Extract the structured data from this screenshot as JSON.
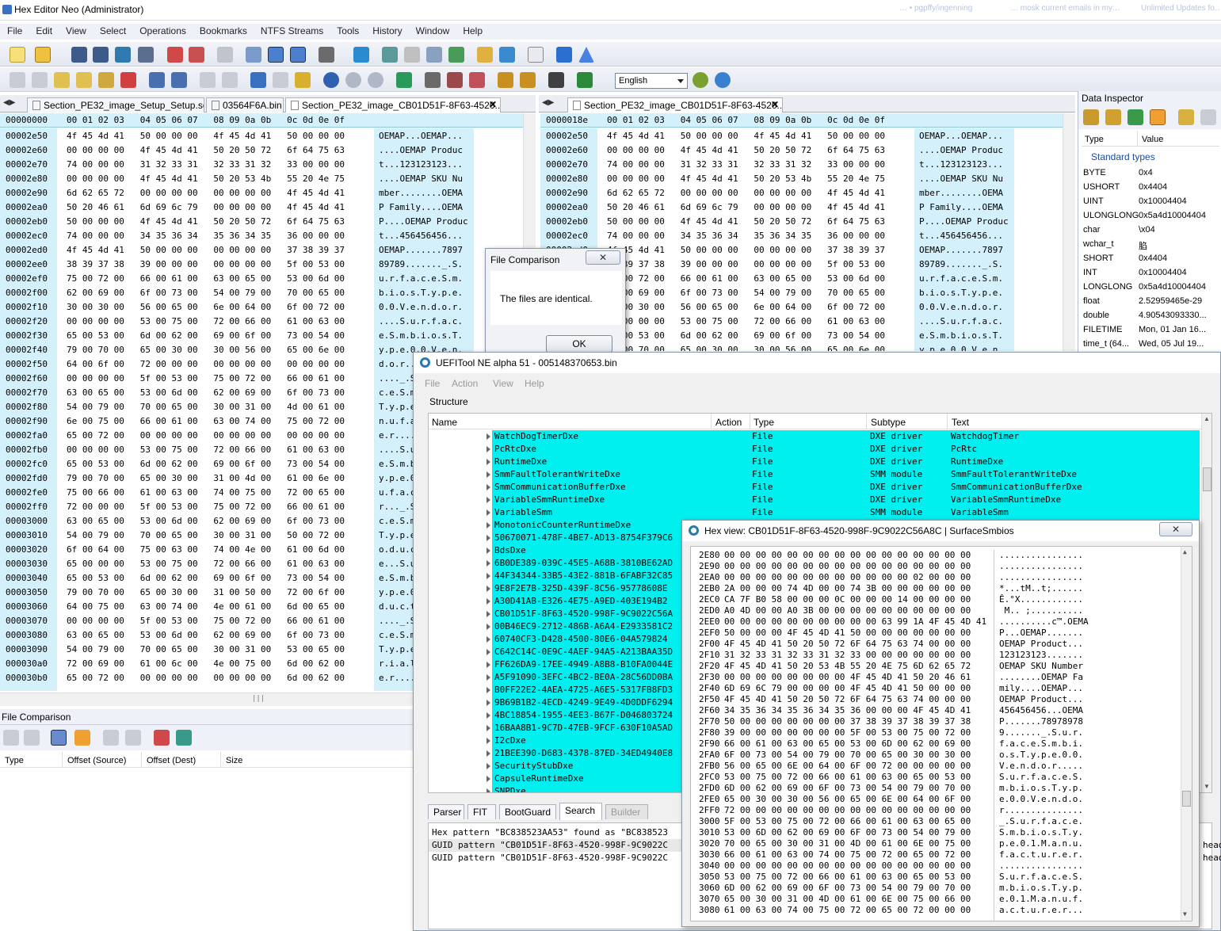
{
  "app": {
    "title": "Hex Editor Neo (Administrator)"
  },
  "taskbar_faint": [
    "… • pgpffy/ingenning",
    "… mosk current emails in my…",
    "Unlimited Updates fo…"
  ],
  "menu": [
    "File",
    "Edit",
    "View",
    "Select",
    "Operations",
    "Bookmarks",
    "NTFS Streams",
    "Tools",
    "History",
    "Window",
    "Help"
  ],
  "toolbar": {
    "language": "English"
  },
  "left_editor": {
    "tabs": [
      "Section_PE32_image_Setup_Setup.sct",
      "03564F6A.bin",
      "Section_PE32_image_CB01D51F-8F63-4520..."
    ],
    "header_offset": "00000000",
    "header_cols": "00 01 02 03   04 05 06 07   08 09 0a 0b   0c 0d 0e 0f",
    "rows": [
      {
        "off": "00002e50",
        "hex": "4f 45 4d 41   50 00 00 00   4f 45 4d 41   50 00 00 00",
        "asc": "OEMAP...OEMAP..."
      },
      {
        "off": "00002e60",
        "hex": "00 00 00 00   4f 45 4d 41   50 20 50 72   6f 64 75 63",
        "asc": "....OEMAP Produc"
      },
      {
        "off": "00002e70",
        "hex": "74 00 00 00   31 32 33 31   32 33 31 32   33 00 00 00",
        "asc": "t...123123123..."
      },
      {
        "off": "00002e80",
        "hex": "00 00 00 00   4f 45 4d 41   50 20 53 4b   55 20 4e 75",
        "asc": "....OEMAP SKU Nu"
      },
      {
        "off": "00002e90",
        "hex": "6d 62 65 72   00 00 00 00   00 00 00 00   4f 45 4d 41",
        "asc": "mber........OEMA"
      },
      {
        "off": "00002ea0",
        "hex": "50 20 46 61   6d 69 6c 79   00 00 00 00   4f 45 4d 41",
        "asc": "P Family....OEMA"
      },
      {
        "off": "00002eb0",
        "hex": "50 00 00 00   4f 45 4d 41   50 20 50 72   6f 64 75 63",
        "asc": "P....OEMAP Produc"
      },
      {
        "off": "00002ec0",
        "hex": "74 00 00 00   34 35 36 34   35 36 34 35   36 00 00 00",
        "asc": "t...456456456..."
      },
      {
        "off": "00002ed0",
        "hex": "4f 45 4d 41   50 00 00 00   00 00 00 00   37 38 39 37",
        "asc": "OEMAP.......7897"
      },
      {
        "off": "00002ee0",
        "hex": "38 39 37 38   39 00 00 00   00 00 00 00   5f 00 53 00",
        "asc": "89789......._.S."
      },
      {
        "off": "00002ef0",
        "hex": "75 00 72 00   66 00 61 00   63 00 65 00   53 00 6d 00",
        "asc": "u.r.f.a.c.e.S.m."
      },
      {
        "off": "00002f00",
        "hex": "62 00 69 00   6f 00 73 00   54 00 79 00   70 00 65 00",
        "asc": "b.i.o.s.T.y.p.e."
      },
      {
        "off": "00002f10",
        "hex": "30 00 30 00   56 00 65 00   6e 00 64 00   6f 00 72 00",
        "asc": "0.0.V.e.n.d.o.r."
      },
      {
        "off": "00002f20",
        "hex": "00 00 00 00   53 00 75 00   72 00 66 00   61 00 63 00",
        "asc": "....S.u.r.f.a.c."
      },
      {
        "off": "00002f30",
        "hex": "65 00 53 00   6d 00 62 00   69 00 6f 00   73 00 54 00",
        "asc": "e.S.m.b.i.o.s.T."
      },
      {
        "off": "00002f40",
        "hex": "79 00 70 00   65 00 30 00   30 00 56 00   65 00 6e 00",
        "asc": "y.p.e.0.0.V.e.n."
      },
      {
        "off": "00002f50",
        "hex": "64 00 6f 00   72 00 00 00   00 00 00 00   00 00 00 00",
        "asc": "d.o.r..........."
      },
      {
        "off": "00002f60",
        "hex": "00 00 00 00   5f 00 53 00   75 00 72 00   66 00 61 00",
        "asc": "...._.S.u.r.f.a."
      },
      {
        "off": "00002f70",
        "hex": "63 00 65 00   53 00 6d 00   62 00 69 00   6f 00 73 00",
        "asc": "c.e.S.m.b.i.o.s."
      },
      {
        "off": "00002f80",
        "hex": "54 00 79 00   70 00 65 00   30 00 31 00   4d 00 61 00",
        "asc": "T.y.p.e.0.1.M.a."
      },
      {
        "off": "00002f90",
        "hex": "6e 00 75 00   66 00 61 00   63 00 74 00   75 00 72 00",
        "asc": "n.u.f.a.c.t.u.r."
      },
      {
        "off": "00002fa0",
        "hex": "65 00 72 00   00 00 00 00   00 00 00 00   00 00 00 00",
        "asc": "e.r............."
      },
      {
        "off": "00002fb0",
        "hex": "00 00 00 00   53 00 75 00   72 00 66 00   61 00 63 00",
        "asc": "....S.u.r.f.a.c."
      },
      {
        "off": "00002fc0",
        "hex": "65 00 53 00   6d 00 62 00   69 00 6f 00   73 00 54 00",
        "asc": "e.S.m.b.i.o.s.T."
      },
      {
        "off": "00002fd0",
        "hex": "79 00 70 00   65 00 30 00   31 00 4d 00   61 00 6e 00",
        "asc": "y.p.e.0.1.M.a.n."
      },
      {
        "off": "00002fe0",
        "hex": "75 00 66 00   61 00 63 00   74 00 75 00   72 00 65 00",
        "asc": "u.f.a.c.t.u.r.e."
      },
      {
        "off": "00002ff0",
        "hex": "72 00 00 00   5f 00 53 00   75 00 72 00   66 00 61 00",
        "asc": "r..._.S.u.r.f.a."
      },
      {
        "off": "00003000",
        "hex": "63 00 65 00   53 00 6d 00   62 00 69 00   6f 00 73 00",
        "asc": "c.e.S.m.b.i.o.s."
      },
      {
        "off": "00003010",
        "hex": "54 00 79 00   70 00 65 00   30 00 31 00   50 00 72 00",
        "asc": "T.y.p.e.0.1.P.r."
      },
      {
        "off": "00003020",
        "hex": "6f 00 64 00   75 00 63 00   74 00 4e 00   61 00 6d 00",
        "asc": "o.d.u.c.t.N.a.m."
      },
      {
        "off": "00003030",
        "hex": "65 00 00 00   53 00 75 00   72 00 66 00   61 00 63 00",
        "asc": "e...S.u.r.f.a.c."
      },
      {
        "off": "00003040",
        "hex": "65 00 53 00   6d 00 62 00   69 00 6f 00   73 00 54 00",
        "asc": "e.S.m.b.i.o.s.T."
      },
      {
        "off": "00003050",
        "hex": "79 00 70 00   65 00 30 00   31 00 50 00   72 00 6f 00",
        "asc": "y.p.e.0.1.P.r.o."
      },
      {
        "off": "00003060",
        "hex": "64 00 75 00   63 00 74 00   4e 00 61 00   6d 00 65 00",
        "asc": "d.u.c.t.N.a.m.e."
      },
      {
        "off": "00003070",
        "hex": "00 00 00 00   5f 00 53 00   75 00 72 00   66 00 61 00",
        "asc": "...._.S.u.r.f.a."
      },
      {
        "off": "00003080",
        "hex": "63 00 65 00   53 00 6d 00   62 00 69 00   6f 00 73 00",
        "asc": "c.e.S.m.b.i.o.s."
      },
      {
        "off": "00003090",
        "hex": "54 00 79 00   70 00 65 00   30 00 31 00   53 00 65 00",
        "asc": "T.y.p.e.0.1.S.e."
      },
      {
        "off": "000030a0",
        "hex": "72 00 69 00   61 00 6c 00   4e 00 75 00   6d 00 62 00",
        "asc": "r.i.a.l.N.u.m.b."
      },
      {
        "off": "000030b0",
        "hex": "65 00 72 00   00 00 00 00   00 00 00 00   6d 00 62 00",
        "asc": "e.r.........m.b."
      }
    ]
  },
  "right_editor": {
    "tabs": [
      "Section_PE32_image_CB01D51F-8F63-4520..."
    ],
    "header_offset": "0000018e",
    "header_cols": "00 01 02 03   04 05 06 07   08 09 0a 0b   0c 0d 0e 0f",
    "rows": [
      {
        "off": "00002e50",
        "hex": "4f 45 4d 41   50 00 00 00   4f 45 4d 41   50 00 00 00",
        "asc": "OEMAP...OEMAP..."
      },
      {
        "off": "00002e60",
        "hex": "00 00 00 00   4f 45 4d 41   50 20 50 72   6f 64 75 63",
        "asc": "....OEMAP Produc"
      },
      {
        "off": "00002e70",
        "hex": "74 00 00 00   31 32 33 31   32 33 31 32   33 00 00 00",
        "asc": "t...123123123..."
      },
      {
        "off": "00002e80",
        "hex": "00 00 00 00   4f 45 4d 41   50 20 53 4b   55 20 4e 75",
        "asc": "....OEMAP SKU Nu"
      },
      {
        "off": "00002e90",
        "hex": "6d 62 65 72   00 00 00 00   00 00 00 00   4f 45 4d 41",
        "asc": "mber........OEMA"
      },
      {
        "off": "00002ea0",
        "hex": "50 20 46 61   6d 69 6c 79   00 00 00 00   4f 45 4d 41",
        "asc": "P Family....OEMA"
      },
      {
        "off": "00002eb0",
        "hex": "50 00 00 00   4f 45 4d 41   50 20 50 72   6f 64 75 63",
        "asc": "P....OEMAP Produc"
      },
      {
        "off": "00002ec0",
        "hex": "74 00 00 00   34 35 36 34   35 36 34 35   36 00 00 00",
        "asc": "t...456456456..."
      },
      {
        "off": "00002ed0",
        "hex": "4f 45 4d 41   50 00 00 00   00 00 00 00   37 38 39 37",
        "asc": "OEMAP.......7897"
      },
      {
        "off": "00002ee0",
        "hex": "38 39 37 38   39 00 00 00   00 00 00 00   5f 00 53 00",
        "asc": "89789......._.S."
      },
      {
        "off": "00002ef0",
        "hex": "75 00 72 00   66 00 61 00   63 00 65 00   53 00 6d 00",
        "asc": "u.r.f.a.c.e.S.m."
      },
      {
        "off": "00002f00",
        "hex": "62 00 69 00   6f 00 73 00   54 00 79 00   70 00 65 00",
        "asc": "b.i.o.s.T.y.p.e."
      },
      {
        "off": "00002f10",
        "hex": "30 00 30 00   56 00 65 00   6e 00 64 00   6f 00 72 00",
        "asc": "0.0.V.e.n.d.o.r."
      },
      {
        "off": "00002f20",
        "hex": "00 00 00 00   53 00 75 00   72 00 66 00   61 00 63 00",
        "asc": "....S.u.r.f.a.c."
      },
      {
        "off": "00002f30",
        "hex": "65 00 53 00   6d 00 62 00   69 00 6f 00   73 00 54 00",
        "asc": "e.S.m.b.i.o.s.T."
      },
      {
        "off": "00002f40",
        "hex": "79 00 70 00   65 00 30 00   30 00 56 00   65 00 6e 00",
        "asc": "y.p.e.0.0.V.e.n."
      }
    ]
  },
  "data_inspector": {
    "title": "Data Inspector",
    "col_type": "Type",
    "col_value": "Value",
    "group": "Standard types",
    "rows": [
      {
        "type": "BYTE",
        "value": "0x4"
      },
      {
        "type": "USHORT",
        "value": "0x4404"
      },
      {
        "type": "UINT",
        "value": "0x10004404"
      },
      {
        "type": "ULONGLONG",
        "value": "0x5a4d10004404"
      },
      {
        "type": "char",
        "value": "\\x04"
      },
      {
        "type": "wchar_t",
        "value": "䐄"
      },
      {
        "type": "SHORT",
        "value": "0x4404"
      },
      {
        "type": "INT",
        "value": "0x10004404"
      },
      {
        "type": "LONGLONG",
        "value": "0x5a4d10004404"
      },
      {
        "type": "float",
        "value": "2.52959465e-29"
      },
      {
        "type": "double",
        "value": "4.90543093330..."
      },
      {
        "type": "FILETIME",
        "value": "Mon, 01 Jan 16..."
      },
      {
        "type": "time_t (64...",
        "value": "Wed, 05 Jul 19..."
      }
    ]
  },
  "file_comparison_panel": {
    "title": "File Comparison",
    "columns": [
      "Type",
      "Offset (Source)",
      "Offset (Dest)",
      "Size"
    ]
  },
  "file_comparison_dialog": {
    "title": "File Comparison",
    "message": "The files are identical.",
    "ok": "OK",
    "close": "✕"
  },
  "uefitool": {
    "title": "UEFITool NE alpha 51 - 005148370653.bin",
    "menu": [
      "File",
      "Action",
      "View",
      "Help"
    ],
    "structure_label": "Structure",
    "columns": [
      "Name",
      "Action",
      "Type",
      "Subtype",
      "Text"
    ],
    "rows": [
      {
        "name": "WatchDogTimerDxe",
        "type": "File",
        "subtype": "DXE driver",
        "text": "WatchdogTimer"
      },
      {
        "name": "PcRtcDxe",
        "type": "File",
        "subtype": "DXE driver",
        "text": "PcRtc"
      },
      {
        "name": "RuntimeDxe",
        "type": "File",
        "subtype": "DXE driver",
        "text": "RuntimeDxe"
      },
      {
        "name": "SmmFaultTolerantWriteDxe",
        "type": "File",
        "subtype": "SMM module",
        "text": "SmmFaultTolerantWriteDxe"
      },
      {
        "name": "SmmCommunicationBufferDxe",
        "type": "File",
        "subtype": "DXE driver",
        "text": "SmmCommunicationBufferDxe"
      },
      {
        "name": "VariableSmmRuntimeDxe",
        "type": "File",
        "subtype": "DXE driver",
        "text": "VariableSmmRuntimeDxe"
      },
      {
        "name": "VariableSmm",
        "type": "File",
        "subtype": "SMM module",
        "text": "VariableSmm"
      },
      {
        "name": "MonotonicCounterRuntimeDxe",
        "type": "",
        "subtype": "",
        "text": ""
      },
      {
        "name": "50670071-478F-4BE7-AD13-8754F379C6",
        "type": "",
        "subtype": "",
        "text": ""
      },
      {
        "name": "BdsDxe",
        "type": "",
        "subtype": "",
        "text": ""
      },
      {
        "name": "6B0DE389-039C-45E5-A68B-3810BE62AD",
        "type": "",
        "subtype": "",
        "text": ""
      },
      {
        "name": "44F34344-33B5-43E2-881B-6FABF32C85",
        "type": "",
        "subtype": "",
        "text": ""
      },
      {
        "name": "9E8F2E7B-325D-439F-8C56-95778608E",
        "type": "",
        "subtype": "",
        "text": ""
      },
      {
        "name": "A30D41AB-E326-4E75-A9ED-403E194B2",
        "type": "",
        "subtype": "",
        "text": ""
      },
      {
        "name": "CB01D51F-8F63-4520-998F-9C9022C56A",
        "type": "",
        "subtype": "",
        "text": ""
      },
      {
        "name": "00B46EC9-2712-486B-A6A4-E2933581C2",
        "type": "",
        "subtype": "",
        "text": ""
      },
      {
        "name": "60740CF3-D428-4500-80E6-04A579824",
        "type": "",
        "subtype": "",
        "text": ""
      },
      {
        "name": "C642C14C-0E9C-4AEF-94A5-A213BAA35D",
        "type": "",
        "subtype": "",
        "text": ""
      },
      {
        "name": "FF626DA9-17EE-4949-A8B8-B10FA0044E",
        "type": "",
        "subtype": "",
        "text": ""
      },
      {
        "name": "A5F91090-3EFC-4BC2-BE0A-28C56DD0BA",
        "type": "",
        "subtype": "",
        "text": ""
      },
      {
        "name": "B0FF22E2-4AEA-4725-A6E5-5317FB8FD3",
        "type": "",
        "subtype": "",
        "text": ""
      },
      {
        "name": "9B69B1B2-4ECD-4249-9E49-4D0DDF6294",
        "type": "",
        "subtype": "",
        "text": ""
      },
      {
        "name": "4BC18854-1955-4EE3-B67F-D046803724",
        "type": "",
        "subtype": "",
        "text": ""
      },
      {
        "name": "16BAA8B1-9C7D-47EB-9FCF-630F10A5AD",
        "type": "",
        "subtype": "",
        "text": ""
      },
      {
        "name": "I2cDxe",
        "type": "",
        "subtype": "",
        "text": ""
      },
      {
        "name": "21BEE390-D683-4378-87ED-34ED4940E8",
        "type": "",
        "subtype": "",
        "text": ""
      },
      {
        "name": "SecurityStubDxe",
        "type": "",
        "subtype": "",
        "text": ""
      },
      {
        "name": "CapsuleRuntimeDxe",
        "type": "",
        "subtype": "",
        "text": ""
      },
      {
        "name": "SNPDxe",
        "type": "",
        "subtype": "",
        "text": ""
      }
    ],
    "tabs": [
      "Parser",
      "FIT",
      "BootGuard",
      "Search",
      "Builder"
    ],
    "messages": [
      "Hex pattern \"BC838523AA53\" found as \"BC838523",
      "GUID pattern \"CB01D51F-8F63-4520-998F-9C9022C",
      "GUID pattern \"CB01D51F-8F63-4520-998F-9C9022C"
    ],
    "overflow_right": [
      "head",
      "head"
    ]
  },
  "hexview": {
    "title": "Hex view: CB01D51F-8F63-4520-998F-9C9022C56A8C | SurfaceSmbios",
    "rows": [
      {
        "off": "2E80",
        "hex": "00 00 00 00 00 00 00 00 00 00 00 00 00 00 00 00",
        "asc": "................"
      },
      {
        "off": "2E90",
        "hex": "00 00 00 00 00 00 00 00 00 00 00 00 00 00 00 00",
        "asc": "................"
      },
      {
        "off": "2EA0",
        "hex": "00 00 00 00 00 00 00 00 00 00 00 00 02 00 00 00",
        "asc": "................"
      },
      {
        "off": "2EB0",
        "hex": "2A 00 00 00 74 4D 00 00 74 3B 00 00 00 00 00 00",
        "asc": "*...tM..t;......"
      },
      {
        "off": "2EC0",
        "hex": "CA 7F B0 58 00 00 00 0C 00 00 00 14 00 00 00 00",
        "asc": "Ê.°X............"
      },
      {
        "off": "2ED0",
        "hex": "A0 4D 00 00 A0 3B 00 00 00 00 00 00 00 00 00 00",
        "asc": " M.. ;.........."
      },
      {
        "off": "2EE0",
        "hex": "00 00 00 00 00 00 00 00 00 00 63 99 1A 4F 45 4D 41",
        "asc": "..........c™.OEMA"
      },
      {
        "off": "2EF0",
        "hex": "50 00 00 00 4F 45 4D 41 50 00 00 00 00 00 00 00",
        "asc": "P...OEMAP......."
      },
      {
        "off": "2F00",
        "hex": "4F 45 4D 41 50 20 50 72 6F 64 75 63 74 00 00 00",
        "asc": "OEMAP Product..."
      },
      {
        "off": "2F10",
        "hex": "31 32 33 31 32 33 31 32 33 00 00 00 00 00 00 00",
        "asc": "123123123......."
      },
      {
        "off": "2F20",
        "hex": "4F 45 4D 41 50 20 53 4B 55 20 4E 75 6D 62 65 72",
        "asc": "OEMAP SKU Number"
      },
      {
        "off": "2F30",
        "hex": "00 00 00 00 00 00 00 00 4F 45 4D 41 50 20 46 61",
        "asc": "........OEMAP Fa"
      },
      {
        "off": "2F40",
        "hex": "6D 69 6C 79 00 00 00 00 4F 45 4D 41 50 00 00 00",
        "asc": "mily....OEMAP..."
      },
      {
        "off": "2F50",
        "hex": "4F 45 4D 41 50 20 50 72 6F 64 75 63 74 00 00 00",
        "asc": "OEMAP Product..."
      },
      {
        "off": "2F60",
        "hex": "34 35 36 34 35 36 34 35 36 00 00 00 4F 45 4D 41",
        "asc": "456456456...OEMA"
      },
      {
        "off": "2F70",
        "hex": "50 00 00 00 00 00 00 00 37 38 39 37 38 39 37 38",
        "asc": "P.......78978978"
      },
      {
        "off": "2F80",
        "hex": "39 00 00 00 00 00 00 00 5F 00 53 00 75 00 72 00",
        "asc": "9......._.S.u.r."
      },
      {
        "off": "2F90",
        "hex": "66 00 61 00 63 00 65 00 53 00 6D 00 62 00 69 00",
        "asc": "f.a.c.e.S.m.b.i."
      },
      {
        "off": "2FA0",
        "hex": "6F 00 73 00 54 00 79 00 70 00 65 00 30 00 30 00",
        "asc": "o.s.T.y.p.e.0.0."
      },
      {
        "off": "2FB0",
        "hex": "56 00 65 00 6E 00 64 00 6F 00 72 00 00 00 00 00",
        "asc": "V.e.n.d.o.r....."
      },
      {
        "off": "2FC0",
        "hex": "53 00 75 00 72 00 66 00 61 00 63 00 65 00 53 00",
        "asc": "S.u.r.f.a.c.e.S."
      },
      {
        "off": "2FD0",
        "hex": "6D 00 62 00 69 00 6F 00 73 00 54 00 79 00 70 00",
        "asc": "m.b.i.o.s.T.y.p."
      },
      {
        "off": "2FE0",
        "hex": "65 00 30 00 30 00 56 00 65 00 6E 00 64 00 6F 00",
        "asc": "e.0.0.V.e.n.d.o."
      },
      {
        "off": "2FF0",
        "hex": "72 00 00 00 00 00 00 00 00 00 00 00 00 00 00 00",
        "asc": "r..............."
      },
      {
        "off": "3000",
        "hex": "5F 00 53 00 75 00 72 00 66 00 61 00 63 00 65 00",
        "asc": "_.S.u.r.f.a.c.e."
      },
      {
        "off": "3010",
        "hex": "53 00 6D 00 62 00 69 00 6F 00 73 00 54 00 79 00",
        "asc": "S.m.b.i.o.s.T.y."
      },
      {
        "off": "3020",
        "hex": "70 00 65 00 30 00 31 00 4D 00 61 00 6E 00 75 00",
        "asc": "p.e.0.1.M.a.n.u."
      },
      {
        "off": "3030",
        "hex": "66 00 61 00 63 00 74 00 75 00 72 00 65 00 72 00",
        "asc": "f.a.c.t.u.r.e.r."
      },
      {
        "off": "3040",
        "hex": "00 00 00 00 00 00 00 00 00 00 00 00 00 00 00 00",
        "asc": "................"
      },
      {
        "off": "3050",
        "hex": "53 00 75 00 72 00 66 00 61 00 63 00 65 00 53 00",
        "asc": "S.u.r.f.a.c.e.S."
      },
      {
        "off": "3060",
        "hex": "6D 00 62 00 69 00 6F 00 73 00 54 00 79 00 70 00",
        "asc": "m.b.i.o.s.T.y.p."
      },
      {
        "off": "3070",
        "hex": "65 00 30 00 31 00 4D 00 61 00 6E 00 75 00 66 00",
        "asc": "e.0.1.M.a.n.u.f."
      },
      {
        "off": "3080",
        "hex": "61 00 63 00 74 00 75 00 72 00 65 00 72 00 00 00",
        "asc": "a.c.t.u.r.e.r..."
      }
    ]
  },
  "colors": {
    "offset_bg": "#d4f0fb",
    "selection_cyan": "#00f0f0",
    "chrome": "#eef1f7"
  }
}
